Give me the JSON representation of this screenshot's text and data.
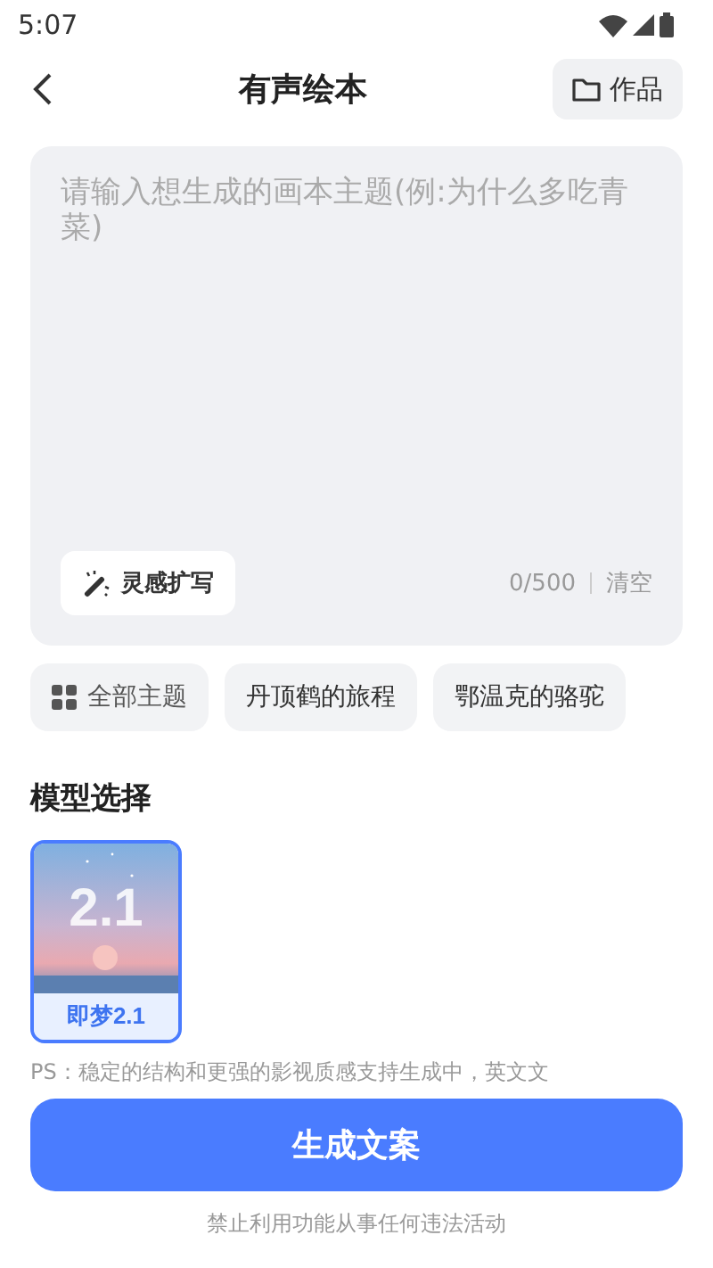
{
  "status_bar": {
    "time": "5:07"
  },
  "header": {
    "title": "有声绘本",
    "works_button": "作品"
  },
  "prompt": {
    "placeholder": "请输入想生成的画本主题(例:为什么多吃青菜)",
    "expand_button": "灵感扩写",
    "counter": "0/500",
    "clear": "清空"
  },
  "topics": [
    {
      "label": "全部主题",
      "kind": "all"
    },
    {
      "label": "丹顶鹤的旅程",
      "kind": "topic"
    },
    {
      "label": "鄂温克的骆驼",
      "kind": "topic"
    }
  ],
  "models": {
    "title": "模型选择",
    "items": [
      {
        "thumbnail_text": "2.1",
        "name": "即梦2.1",
        "selected": true
      }
    ],
    "note": "PS：稳定的结构和更强的影视质感支持生成中，英文文"
  },
  "generate_button": "生成文案",
  "footer": "禁止利用功能从事任何违法活动"
}
